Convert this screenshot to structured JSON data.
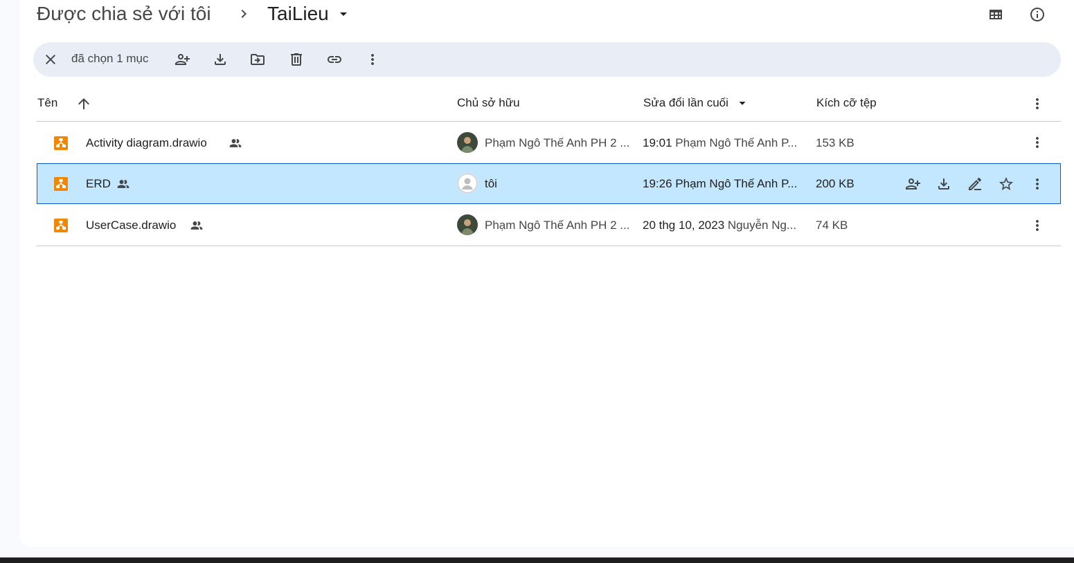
{
  "header": {
    "breadcrumb_root": "Được chia sẻ với tôi",
    "breadcrumb_current": "TaiLieu"
  },
  "selection_bar": {
    "text": "đã chọn 1 mục"
  },
  "table": {
    "columns": {
      "name": "Tên",
      "owner": "Chủ sở hữu",
      "modified": "Sửa đổi lần cuối",
      "size": "Kích cỡ tệp"
    },
    "rows": [
      {
        "name": "Activity diagram.drawio",
        "owner": "Phạm Ngô Thế Anh PH 2 ...",
        "modified_time": "19:01",
        "modified_by": "Phạm Ngô Thế Anh P...",
        "size": "153 KB",
        "selected": false
      },
      {
        "name": "ERD",
        "owner": "tôi",
        "modified_time": "19:26",
        "modified_by": "Phạm Ngô Thế Anh P...",
        "size": "200 KB",
        "selected": true
      },
      {
        "name": "UserCase.drawio",
        "owner": "Phạm Ngô Thế Anh PH 2 ...",
        "modified_time": "20 thg 10, 2023",
        "modified_by": "Nguyễn Ng...",
        "size": "74 KB",
        "selected": false
      }
    ]
  },
  "icons": {
    "file_type": "drawio-icon",
    "shared": "people-icon"
  },
  "colors": {
    "drawio_orange": "#f08705",
    "selected_row_bg": "#c2e7ff",
    "selected_row_border": "#0b57d0",
    "selection_bar_bg": "#e9eef6"
  }
}
